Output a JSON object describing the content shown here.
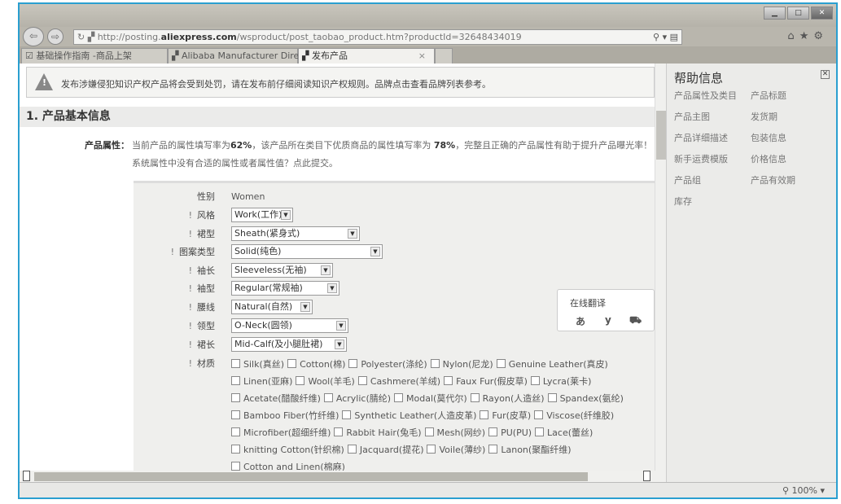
{
  "browser": {
    "url_prefix": "http://posting.",
    "url_domain": "aliexpress.com",
    "url_rest": "/wsproduct/post_taobao_product.htm?productId=32648434019",
    "tabs": [
      {
        "label": "基础操作指南 -商品上架"
      },
      {
        "label": "Alibaba Manufacturer Direc..."
      },
      {
        "label": "发布产品"
      }
    ],
    "tab_close": "×",
    "zoom": "100%"
  },
  "warning": {
    "text": "发布涉嫌侵犯知识产权产品将会受到处罚，请在发布前仔细阅读知识产权规则。品牌点击查看品牌列表参考。"
  },
  "section": {
    "title": "1. 产品基本信息"
  },
  "attributes": {
    "label": "产品属性：",
    "text_a": "当前产品的属性填写率为",
    "rate1": "62%",
    "text_b": "，该产品所在类目下优质商品的属性填写率为 ",
    "rate2": "78%",
    "text_c": "，完整且正确的产品属性有助于提升产品曝光率！",
    "sub": "系统属性中没有合适的属性或者属性值？点此提交。"
  },
  "form": {
    "gender": {
      "label": "性别",
      "value": "Women"
    },
    "fields": [
      {
        "label": "风格",
        "value": "Work(工作)"
      },
      {
        "label": "裙型",
        "value": "Sheath(紧身式)"
      },
      {
        "label": "图案类型",
        "value": "Solid(纯色)"
      },
      {
        "label": "袖长",
        "value": "Sleeveless(无袖)"
      },
      {
        "label": "袖型",
        "value": "Regular(常规袖)"
      },
      {
        "label": "腰线",
        "value": "Natural(自然)"
      },
      {
        "label": "领型",
        "value": "O-Neck(圆领)"
      },
      {
        "label": "裙长",
        "value": "Mid-Calf(及小腿肚裙)"
      }
    ],
    "material_label": "材质",
    "materials": [
      [
        "Silk(真丝)",
        "Cotton(棉)",
        "Polyester(涤纶)",
        "Nylon(尼龙)",
        "Genuine Leather(真皮)"
      ],
      [
        "Linen(亚麻)",
        "Wool(羊毛)",
        "Cashmere(羊绒)",
        "Faux Fur(假皮草)",
        "Lycra(莱卡)"
      ],
      [
        "Acetate(醋酸纤维)",
        "Acrylic(腈纶)",
        "Modal(莫代尔)",
        "Rayon(人造丝)",
        "Spandex(氨纶)"
      ],
      [
        "Bamboo Fiber(竹纤维)",
        "Synthetic Leather(人造皮革)",
        "Fur(皮草)",
        "Viscose(纤维胶)"
      ],
      [
        "Microfiber(超细纤维)",
        "Rabbit Hair(兔毛)",
        "Mesh(网纱)",
        "PU(PU)",
        "Lace(蕾丝)"
      ],
      [
        "knitting Cotton(针织棉)",
        "Jacquard(提花)",
        "Voile(薄纱)",
        "Lanon(聚酯纤维)"
      ],
      [
        "Cotton and Linen(棉麻)"
      ]
    ]
  },
  "translate": {
    "title": "在线翻译"
  },
  "help": {
    "title": "帮助信息",
    "items": [
      "产品属性及类目",
      "产品标题",
      "产品主图",
      "发货期",
      "产品详细描述",
      "包装信息",
      "新手运费模版",
      "价格信息",
      "产品组",
      "产品有效期",
      "库存"
    ]
  }
}
